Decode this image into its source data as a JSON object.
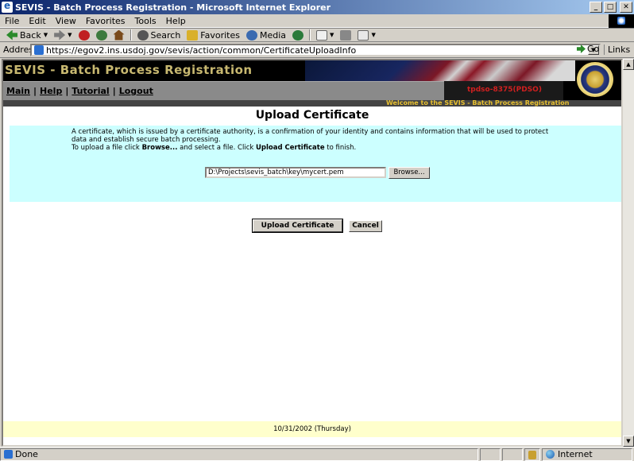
{
  "window": {
    "title": "SEVIS - Batch Process Registration - Microsoft Internet Explorer"
  },
  "menu": {
    "items": [
      {
        "key": "F",
        "rest": "ile"
      },
      {
        "key": "E",
        "rest": "dit"
      },
      {
        "key": "V",
        "rest": "iew"
      },
      {
        "key": "F",
        "rest": "avorites",
        "pre": ""
      },
      {
        "key": "T",
        "rest": "ools"
      },
      {
        "key": "H",
        "rest": "elp"
      }
    ],
    "labels": [
      "File",
      "Edit",
      "View",
      "Favorites",
      "Tools",
      "Help"
    ]
  },
  "toolbar": {
    "back": "Back",
    "search": "Search",
    "favorites": "Favorites",
    "media": "Media"
  },
  "address": {
    "label": "Address",
    "url": "https://egov2.ins.usdoj.gov/sevis/action/common/CertificateUploadInfo",
    "go": "Go",
    "links": "Links"
  },
  "header": {
    "title": "SEVIS - Batch Process Registration",
    "nav": [
      "Main",
      "Help",
      "Tutorial",
      "Logout"
    ],
    "user_id": "tpdso-8375(PDSO)",
    "welcome": "Welcome to the SEVIS - Batch Process Registration"
  },
  "page": {
    "title": "Upload Certificate",
    "info_line1": "A certificate, which is issued by a certificate authority, is a confirmation of your identity and contains information that will be used to protect data and establish secure batch processing.",
    "info_line2_pre": "To upload a file click ",
    "info_line2_b1": "Browse...",
    "info_line2_mid": " and select a file. Click ",
    "info_line2_b2": "Upload Certificate",
    "info_line2_post": " to finish.",
    "file_path": "D:\\Projects\\sevis_batch\\key\\mycert.pem",
    "browse_label": "Browse...",
    "upload_label": "Upload Certificate",
    "cancel_label": "Cancel",
    "footer_date": "10/31/2002 (Thursday)"
  },
  "status": {
    "text": "Done",
    "zone": "Internet"
  }
}
